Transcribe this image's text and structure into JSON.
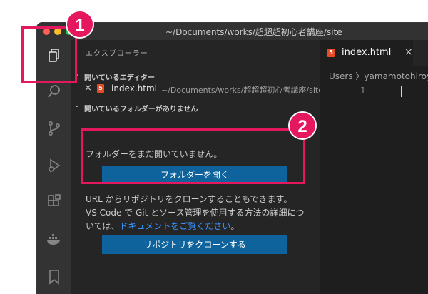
{
  "window": {
    "title": "~/Documents/works/超超超初心者講座/site"
  },
  "activity_bar": {
    "items": [
      {
        "name": "explorer-icon"
      },
      {
        "name": "search-icon"
      },
      {
        "name": "source-control-icon"
      },
      {
        "name": "run-debug-icon"
      },
      {
        "name": "extensions-icon"
      },
      {
        "name": "docker-icon"
      },
      {
        "name": "bookmark-icon"
      }
    ]
  },
  "sidebar": {
    "title": "エクスプローラー",
    "open_editors": {
      "label": "開いているエディター",
      "items": [
        {
          "filename": "index.html",
          "path": "~/Documents/works/超超超初心者講座/site"
        }
      ]
    },
    "no_folder": {
      "label": "開いているフォルダーがありません",
      "message": "フォルダーをまだ開いていません。",
      "open_folder_button": "フォルダーを開く",
      "clone_hint": "URL からリポジトリをクローンすることもできます。",
      "git_line1": "VS Code で Git とソース管理を使用する方法の詳細につ",
      "git_line2_prefix": "いては、",
      "git_link": "ドキュメントをご覧ください",
      "git_line2_suffix": "。",
      "clone_button": "リポジトリをクローンする"
    }
  },
  "editor": {
    "tab": {
      "filename": "index.html",
      "close": "×"
    },
    "breadcrumb": "Users 〉yamamotohiroy",
    "line_number": "1"
  },
  "annotations": {
    "badge1": "1",
    "badge2": "2",
    "color": "#e5175f"
  },
  "icons": {
    "close": "×",
    "chevron": "⌄",
    "html5": "5"
  }
}
